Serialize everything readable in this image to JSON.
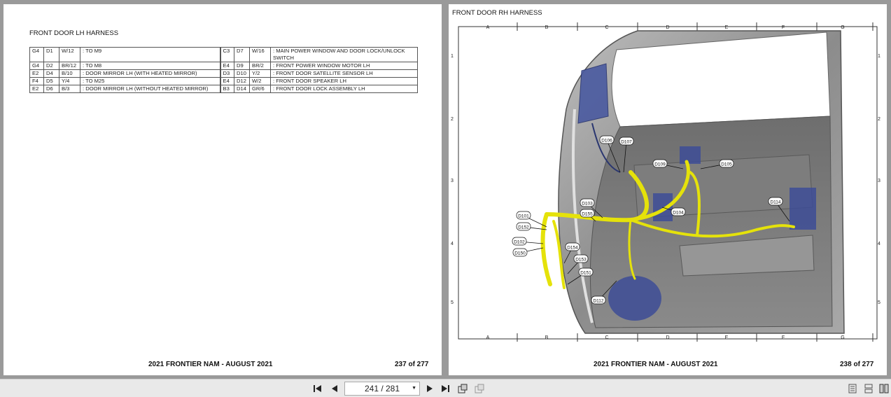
{
  "left_page": {
    "title": "FRONT DOOR LH HARNESS",
    "rows": [
      {
        "a": [
          "G4",
          "D1",
          "W/12",
          ": TO M9"
        ],
        "b": [
          "C3",
          "D7",
          "W/16",
          ": MAIN POWER WINDOW AND DOOR LOCK/UNLOCK SWITCH"
        ]
      },
      {
        "a": [
          "G4",
          "D2",
          "BR/12",
          ": TO M8"
        ],
        "b": [
          "E4",
          "D9",
          "BR/2",
          ": FRONT POWER WINDOW MOTOR LH"
        ]
      },
      {
        "a": [
          "E2",
          "D4",
          "B/10",
          ": DOOR MIRROR LH (WITH HEATED MIRROR)"
        ],
        "b": [
          "D3",
          "D10",
          "Y/2",
          ": FRONT DOOR SATELLITE SENSOR LH"
        ]
      },
      {
        "a": [
          "F4",
          "D5",
          "Y/4",
          ": TO M25"
        ],
        "b": [
          "E4",
          "D12",
          "W/2",
          ": FRONT DOOR SPEAKER LH"
        ]
      },
      {
        "a": [
          "E2",
          "D6",
          "B/3",
          ": DOOR MIRROR LH (WITHOUT HEATED MIRROR)"
        ],
        "b": [
          "B3",
          "D14",
          "GR/6",
          ": FRONT DOOR LOCK ASSEMBLY LH"
        ]
      }
    ],
    "footer_title": "2021 FRONTIER NAM - AUGUST 2021",
    "footer_page": "237 of 277"
  },
  "right_page": {
    "title": "FRONT DOOR RH HARNESS",
    "grid_cols": [
      "A",
      "B",
      "C",
      "D",
      "E",
      "F",
      "G"
    ],
    "grid_rows": [
      "1",
      "2",
      "3",
      "4",
      "5"
    ],
    "connectors": [
      "D106",
      "D107",
      "D109",
      "D105",
      "D103",
      "D155",
      "D101",
      "D152",
      "D102",
      "D150",
      "D154",
      "D153",
      "D151",
      "D104",
      "D114",
      "D112"
    ],
    "footer_title": "2021 FRONTIER NAM - AUGUST 2021",
    "footer_page": "238 of 277"
  },
  "toolbar": {
    "page_indicator": "241 / 281",
    "icons": [
      "first-page-icon",
      "prev-page-icon",
      "next-page-icon",
      "last-page-icon",
      "rotate-icon",
      "copy-icon",
      "single-page-view-icon",
      "continuous-view-icon",
      "two-page-view-icon"
    ]
  }
}
